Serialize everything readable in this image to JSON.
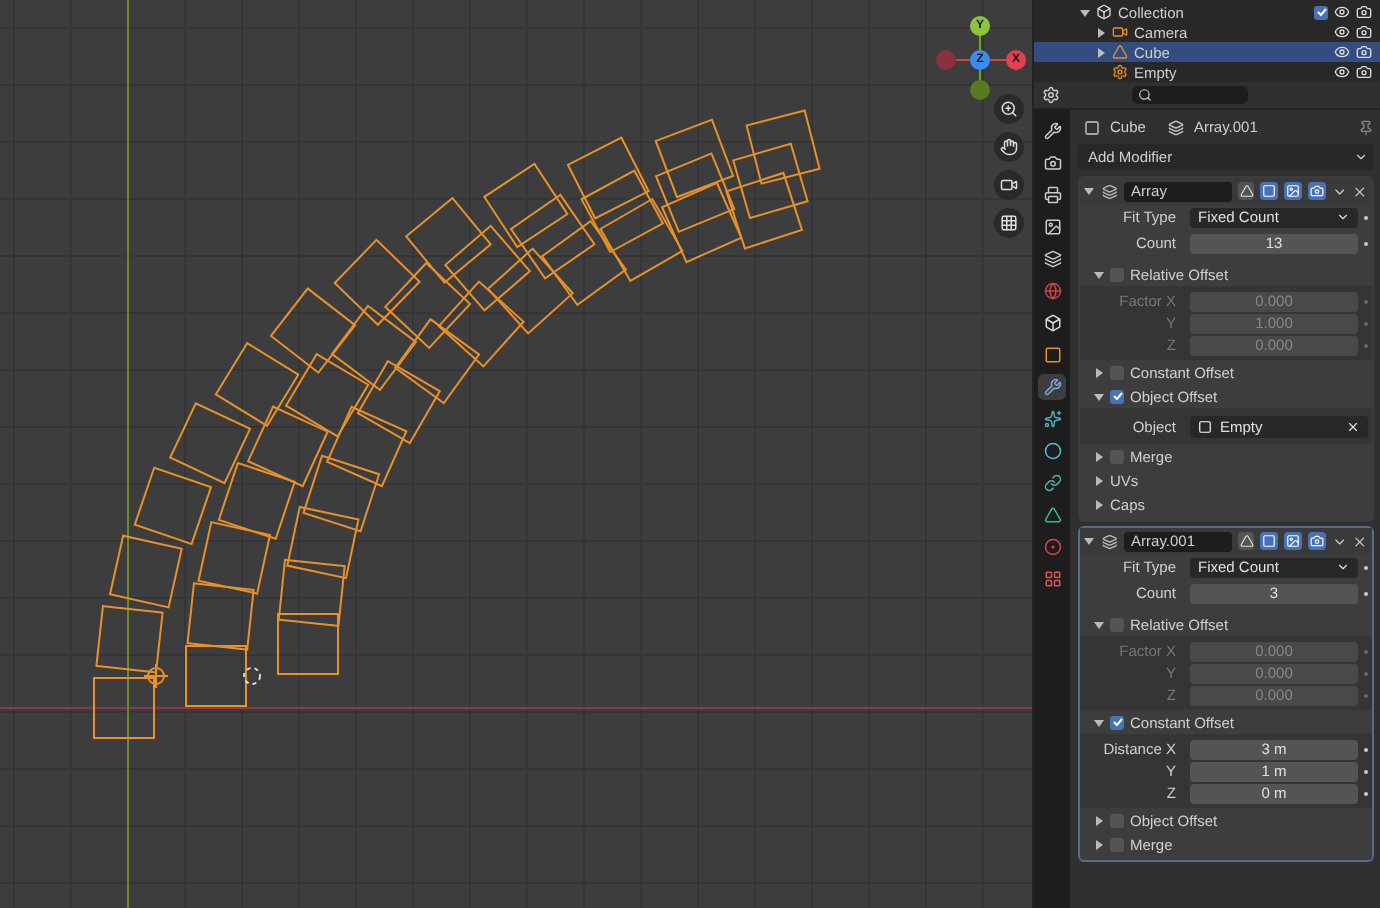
{
  "viewport": {
    "gizmo": {
      "x": "X",
      "y": "Y",
      "z": "Z"
    }
  },
  "outliner": {
    "items": [
      {
        "name": "Collection",
        "kind": "collection",
        "expanded": true,
        "visible": true,
        "checked": true,
        "selected": false,
        "children": [
          {
            "name": "Camera",
            "kind": "camera",
            "expanded": false,
            "visible": true,
            "selected": false
          },
          {
            "name": "Cube",
            "kind": "mesh",
            "expanded": false,
            "visible": true,
            "selected": true
          },
          {
            "name": "Empty",
            "kind": "empty",
            "visible": true,
            "selected": false
          }
        ]
      }
    ]
  },
  "properties": {
    "tabs": [
      {
        "selected": false
      },
      {
        "selected": false
      },
      {
        "selected": false
      },
      {
        "selected": false
      },
      {
        "selected": false
      },
      {
        "selected": false
      },
      {
        "selected": false
      },
      {
        "selected": false
      },
      {
        "selected": true
      },
      {
        "selected": false
      },
      {
        "selected": false
      },
      {
        "selected": false
      },
      {
        "selected": false
      },
      {
        "selected": false
      },
      {
        "selected": false
      }
    ],
    "breadcrumb": {
      "object": "Cube",
      "modifier": "Array.001"
    },
    "add_modifier": "Add Modifier",
    "modifiers": [
      {
        "name": "Array",
        "expanded": true,
        "fit_type_label": "Fit Type",
        "fit_type": "Fixed Count",
        "count_label": "Count",
        "count": "13",
        "sections": [
          {
            "label": "Relative Offset",
            "kind": "checkbox",
            "checked": false,
            "expanded": true,
            "fields": [
              {
                "label": "Factor X",
                "value": "0.000"
              },
              {
                "label": "Y",
                "value": "1.000"
              },
              {
                "label": "Z",
                "value": "0.000"
              }
            ]
          },
          {
            "label": "Constant Offset",
            "kind": "checkbox",
            "checked": false,
            "expanded": false
          },
          {
            "label": "Object Offset",
            "kind": "checkbox",
            "checked": true,
            "expanded": true,
            "fields": [
              {
                "label": "Object",
                "value": "Empty",
                "kind": "object"
              }
            ]
          },
          {
            "label": "Merge",
            "kind": "checkbox",
            "checked": false,
            "expanded": false
          },
          {
            "label": "UVs",
            "kind": "plain",
            "expanded": false
          },
          {
            "label": "Caps",
            "kind": "plain",
            "expanded": false
          }
        ]
      },
      {
        "name": "Array.001",
        "expanded": true,
        "fit_type_label": "Fit Type",
        "fit_type": "Fixed Count",
        "count_label": "Count",
        "count": "3",
        "sections": [
          {
            "label": "Relative Offset",
            "kind": "checkbox",
            "checked": false,
            "expanded": true,
            "fields": [
              {
                "label": "Factor X",
                "value": "0.000"
              },
              {
                "label": "Y",
                "value": "0.000"
              },
              {
                "label": "Z",
                "value": "0.000"
              }
            ]
          },
          {
            "label": "Constant Offset",
            "kind": "checkbox",
            "checked": true,
            "expanded": true,
            "fields": [
              {
                "label": "Distance X",
                "value": "3 m"
              },
              {
                "label": "Y",
                "value": "1 m"
              },
              {
                "label": "Z",
                "value": "0 m"
              }
            ]
          },
          {
            "label": "Object Offset",
            "kind": "checkbox",
            "checked": false,
            "expanded": false
          },
          {
            "label": "Merge",
            "kind": "checkbox",
            "checked": false,
            "expanded": false
          }
        ]
      }
    ]
  }
}
